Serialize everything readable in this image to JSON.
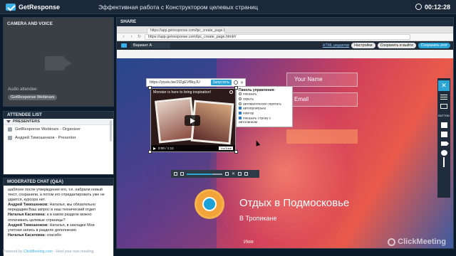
{
  "topbar": {
    "brand": "GetResponse",
    "meeting_title": "Эффективная работа с Конструктором целевых страниц",
    "time": "00:12:28"
  },
  "camera": {
    "heading": "CAMERA AND VOICE",
    "audio_label": "Audio attendee:",
    "audio_name": "GetResponse Webinars"
  },
  "attendees": {
    "heading": "ATTENDEE LIST",
    "group": "PRESENTERS",
    "items": [
      "GetResponse Webinars - Organizer",
      "Андрей Тимошенков - Presenter"
    ]
  },
  "chat": {
    "heading": "MODERATED CHAT (Q&A)",
    "lines": [
      {
        "who": "",
        "text": "шаблоне после утверждения его, т.е. набрали новый текст, сохранили, а потом его отредактировать уже не удается, курсора нет."
      },
      {
        "who": "Андрей Тимошенков:",
        "text": "Наталья, мы обязательно передадим Ваш запрос в наш технический отдел"
      },
      {
        "who": "Наталья Касаткина:",
        "text": "а в каком разделе можно оплачивать целевые страницы?"
      },
      {
        "who": "Андрей Тимошенков:",
        "text": "Наталья, в закладке Мои учетная запись в разделе дополнения"
      },
      {
        "who": "Наталья Касаткина:",
        "text": "спасибо"
      }
    ]
  },
  "share": {
    "heading": "SHARE",
    "tab_title": "https://app.getresponse.com/lpc_create_page.html",
    "url": "https://app.getresponse.com/lpc_create_page.html#/",
    "variant": "Вариант A",
    "html_link": "HTML редактор",
    "btn_settings": "Настройки",
    "btn_save": "Сохранить и выйти",
    "btn_publish": "Сохранить этот"
  },
  "landing": {
    "field_name": "Your Name",
    "field_email": "Email",
    "headline": "Отдых в Подмосковье",
    "subheadline": "В Тропикане",
    "name_label": "Имя",
    "watermark": "ClickMeeting"
  },
  "video_widget": {
    "url": "https://youtu.be/2IZgEVBkyJU",
    "run_label": "Запустить",
    "video_title": "Monster is here to bring inspiration!",
    "time": "0:00 / 1:12",
    "yt": "YouTube",
    "panel_title": "Панель управления:",
    "opt_show": "показать",
    "opt_hide": "скрыть",
    "opt_auto": "автоматически спрятать",
    "chk_autoplay": "автопроигрыш",
    "chk_loop": "повтор",
    "chk_related": "показать строку с автолинком"
  },
  "footer": {
    "prefix": "Powered by",
    "brand": "ClickMeeting.com",
    "suffix": "- Host your own meeting"
  }
}
